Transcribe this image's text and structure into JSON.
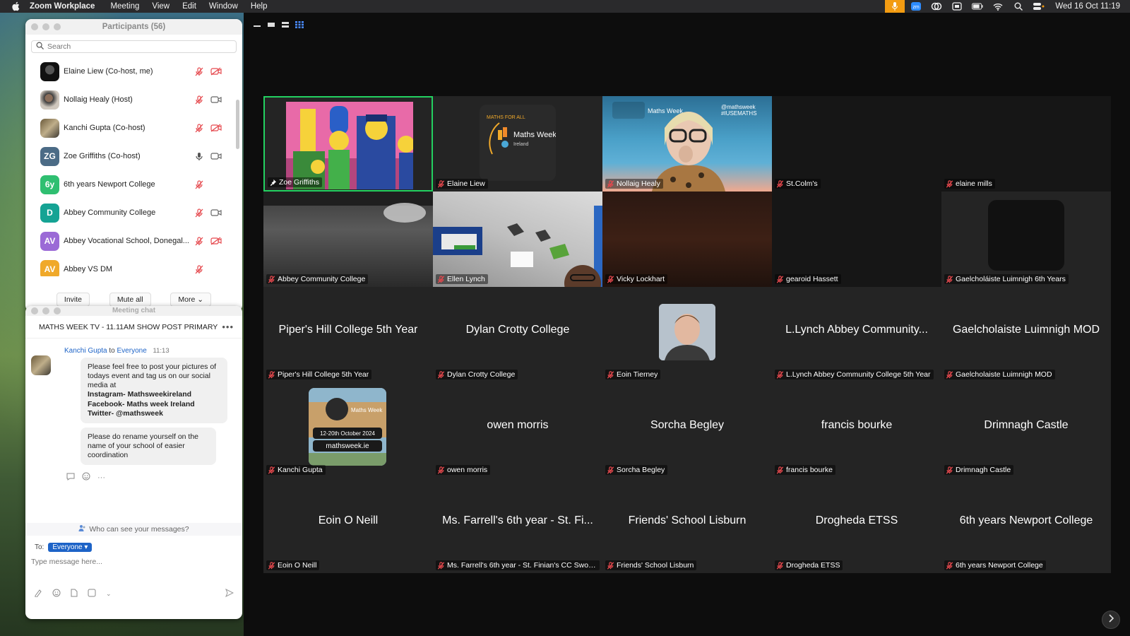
{
  "menubar": {
    "app_name": "Zoom Workplace",
    "menus": [
      "Meeting",
      "View",
      "Edit",
      "Window",
      "Help"
    ],
    "clock": "Wed 16 Oct  11:19",
    "accent_color": "#f39c12"
  },
  "participants": {
    "title": "Participants (56)",
    "search_placeholder": "Search",
    "items": [
      {
        "name": "Elaine Liew (Co-host, me)",
        "avatar": "photo",
        "mic": "muted",
        "cam": "off"
      },
      {
        "name": "Nollaig Healy (Host)",
        "avatar": "photo",
        "mic": "muted",
        "cam": "on"
      },
      {
        "name": "Kanchi Gupta (Co-host)",
        "avatar": "photo",
        "mic": "muted",
        "cam": "off"
      },
      {
        "name": "Zoe Griffiths (Co-host)",
        "initials": "ZG",
        "color": "#4b6b86",
        "mic": "on",
        "cam": "on"
      },
      {
        "name": "6th years Newport College",
        "initials": "6y",
        "color": "#2fbf71",
        "mic": "muted",
        "cam": "none"
      },
      {
        "name": "Abbey Community College",
        "initials": "D",
        "color": "#15a394",
        "mic": "muted",
        "cam": "on"
      },
      {
        "name": "Abbey Vocational School, Donegal...",
        "initials": "AV",
        "color": "#9b6ad6",
        "mic": "muted",
        "cam": "off"
      },
      {
        "name": "Abbey VS DM",
        "initials": "AV",
        "color": "#f0a92a",
        "mic": "muted",
        "cam": "none"
      }
    ],
    "footer": {
      "invite": "Invite",
      "mute_all": "Mute all",
      "more": "More"
    }
  },
  "chat": {
    "title": "Meeting chat",
    "topic": "MATHS WEEK TV - 11.11AM SHOW POST PRIMARY",
    "message": {
      "sender": "Kanchi Gupta",
      "to_word": "to",
      "recipient": "Everyone",
      "time": "11:13",
      "text1": "Please feel free to post your pictures of todays event and tag us on our social media at",
      "line_instagram": "Instagram- Mathsweekireland",
      "line_facebook": "Facebook- Maths week Ireland",
      "line_twitter": "Twitter- @mathsweek",
      "text2": "Please do rename yourself on the name of your school of easier coordination"
    },
    "privacy": "Who can see your messages?",
    "to_label": "To:",
    "to_value": "Everyone",
    "input_placeholder": "Type message here..."
  },
  "gallery": {
    "active_color": "#23d160",
    "tiles": [
      {
        "label": "Zoe Griffiths",
        "kind": "simpsons",
        "active": true
      },
      {
        "label": "Elaine Liew",
        "kind": "logo"
      },
      {
        "label": "Nollaig Healy",
        "kind": "nollaig"
      },
      {
        "label": "St.Colm's",
        "kind": "dark"
      },
      {
        "label": "elaine mills",
        "kind": "dark"
      },
      {
        "label": "Abbey Community College",
        "kind": "room"
      },
      {
        "label": "Ellen Lynch",
        "kind": "ceiling"
      },
      {
        "label": "Vicky Lockhart",
        "kind": "vicky"
      },
      {
        "label": "gearoid Hassett",
        "kind": "dark"
      },
      {
        "label": "Gaelcholáiste Luimnigh 6th Years",
        "kind": "gael"
      },
      {
        "label": "Piper's Hill College 5th Year",
        "big": "Piper's Hill College 5th Year"
      },
      {
        "label": "Dylan Crotty College",
        "big": "Dylan Crotty College"
      },
      {
        "label": "Eoin Tierney",
        "kind": "eoin"
      },
      {
        "label": "L.Lynch Abbey Community College 5th Year",
        "big": "L.Lynch Abbey Community..."
      },
      {
        "label": "Gaelcholaiste Luimnigh MOD",
        "big": "Gaelcholaiste Luimnigh MOD"
      },
      {
        "label": "Kanchi Gupta",
        "kind": "kanchi"
      },
      {
        "label": "owen morris",
        "big": "owen morris"
      },
      {
        "label": "Sorcha Begley",
        "big": "Sorcha Begley"
      },
      {
        "label": "francis bourke",
        "big": "francis bourke"
      },
      {
        "label": "Drimnagh Castle",
        "big": "Drimnagh Castle"
      },
      {
        "label": "Eoin O Neill",
        "big": "Eoin O Neill"
      },
      {
        "label": "Ms. Farrell's 6th year - St. Finian's CC Swords",
        "big": "Ms. Farrell's 6th year - St. Fi..."
      },
      {
        "label": "Friends' School Lisburn",
        "big": "Friends' School Lisburn"
      },
      {
        "label": "Drogheda ETSS",
        "big": "Drogheda ETSS"
      },
      {
        "label": "6th years Newport College",
        "big": "6th years Newport College"
      }
    ],
    "logo_text": "Maths Week",
    "logo_sub": "Ireland",
    "maths_for_all": "MATHS FOR ALL",
    "nollaig_tag1": "@mathsweek",
    "nollaig_tag2": "#IUSEMATHS",
    "kanchi_dates": "12-20th October 2024",
    "kanchi_url": "mathsweek.ie"
  }
}
